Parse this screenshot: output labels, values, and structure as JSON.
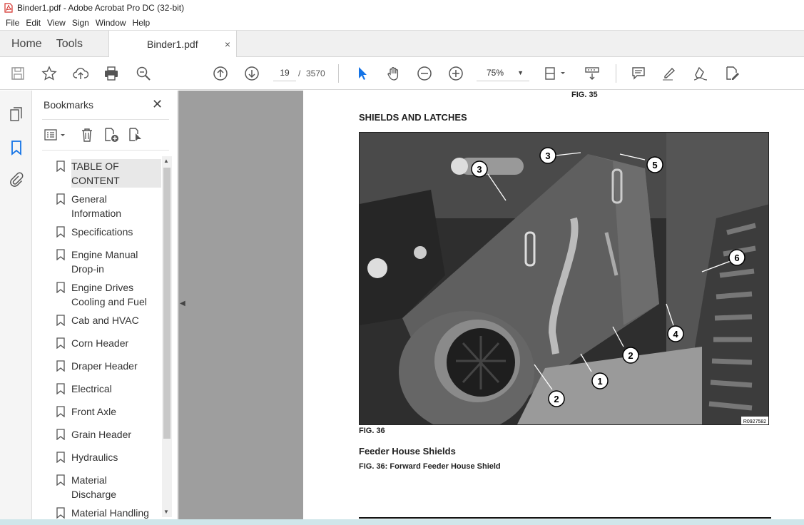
{
  "window": {
    "title": "Binder1.pdf - Adobe Acrobat Pro DC (32-bit)"
  },
  "menu": [
    "File",
    "Edit",
    "View",
    "Sign",
    "Window",
    "Help"
  ],
  "tabs": {
    "home": "Home",
    "tools": "Tools",
    "document": "Binder1.pdf",
    "close_symbol": "×"
  },
  "toolbar": {
    "current_page": "19",
    "page_separator": "/",
    "total_pages": "3570",
    "zoom": "75%"
  },
  "bookmarks": {
    "header": "Bookmarks",
    "close_symbol": "✕",
    "items": [
      {
        "label": "TABLE OF CONTENT",
        "selected": true
      },
      {
        "label": "General Information"
      },
      {
        "label": "Specifications"
      },
      {
        "label": "Engine Manual Drop-in"
      },
      {
        "label": "Engine Drives Cooling and Fuel"
      },
      {
        "label": "Cab and HVAC"
      },
      {
        "label": "Corn Header"
      },
      {
        "label": "Draper Header"
      },
      {
        "label": "Electrical"
      },
      {
        "label": "Front Axle"
      },
      {
        "label": "Grain Header"
      },
      {
        "label": "Hydraulics"
      },
      {
        "label": "Material Discharge"
      },
      {
        "label": "Material Handling"
      }
    ]
  },
  "document": {
    "fig_top": "FIG. 35",
    "section_title": "SHIELDS AND LATCHES",
    "photo_id": "R0927582",
    "callouts": [
      "3",
      "3",
      "5",
      "6",
      "4",
      "2",
      "1",
      "2"
    ],
    "fig_bottom": "FIG. 36",
    "subheading": "Feeder House Shields",
    "caption": "FIG. 36:  Forward Feeder House Shield"
  },
  "colors": {
    "accent_blue": "#1473e6",
    "doc_background": "#9e9e9e"
  }
}
